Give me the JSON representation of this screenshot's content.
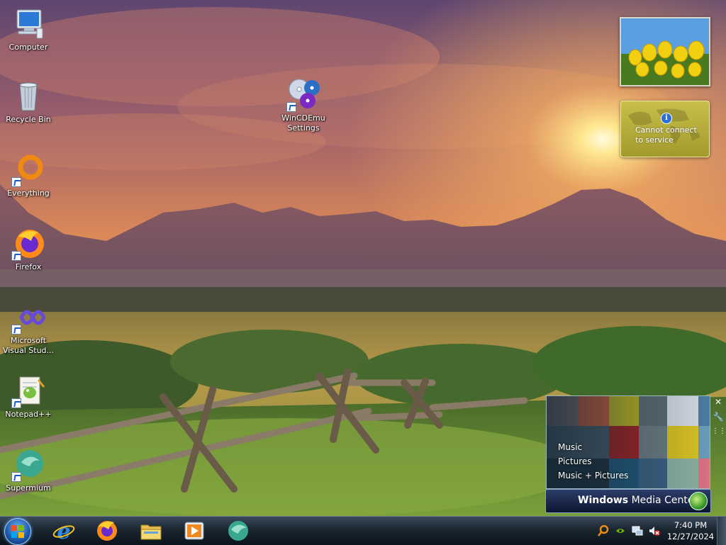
{
  "desktop": {
    "icons": [
      {
        "label": "Computer",
        "icon": "computer-icon"
      },
      {
        "label": "Recycle Bin",
        "icon": "recycle-bin-icon"
      },
      {
        "label": "Everything",
        "icon": "everything-search-icon"
      },
      {
        "label": "Firefox",
        "icon": "firefox-icon"
      },
      {
        "label": "Microsoft Visual Stud...",
        "icon": "visual-studio-icon"
      },
      {
        "label": "Notepad++",
        "icon": "notepad-plus-plus-icon"
      },
      {
        "label": "Supermium",
        "icon": "supermium-icon"
      },
      {
        "label": "WinCDEmu Settings",
        "icon": "wincdemu-icon"
      }
    ]
  },
  "gadgets": {
    "weather": {
      "message": "Cannot connect to service"
    },
    "media_center": {
      "menu": [
        "Music",
        "Pictures",
        "Music + Pictures"
      ],
      "title_bold": "Windows",
      "title_rest": " Media Center"
    }
  },
  "taskbar": {
    "pinned": [
      "internet-explorer-icon",
      "firefox-icon",
      "file-explorer-icon",
      "media-player-icon",
      "supermium-icon"
    ],
    "clock": {
      "time": "7:40 PM",
      "date": "12/27/2024"
    }
  },
  "colors": {
    "sky_top": "#6b4a6e",
    "sky_glow": "#f0a050",
    "taskbar": "#1a2630",
    "weather_gadget": "#b8af3c"
  }
}
